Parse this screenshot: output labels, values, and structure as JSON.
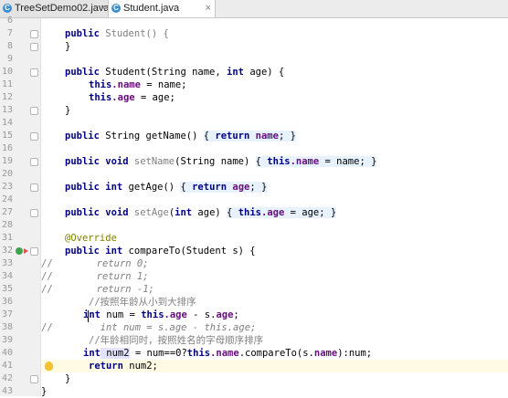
{
  "tabs": [
    {
      "label": "TreeSetDemo02.java",
      "icon": "java-class-icon",
      "active": false
    },
    {
      "label": "Student.java",
      "icon": "java-class-icon",
      "active": true
    }
  ],
  "line_numbers": [
    "6",
    "7",
    "8",
    "9",
    "10",
    "11",
    "12",
    "13",
    "14",
    "15",
    "16",
    "19",
    "20",
    "23",
    "24",
    "27",
    "28",
    "31",
    "32",
    "33",
    "34",
    "35",
    "36",
    "37",
    "38",
    "39",
    "40",
    "41",
    "42",
    "43"
  ],
  "code": {
    "l7": {
      "kw": "public",
      "name": "Student",
      "rest": "() {"
    },
    "l8": "}",
    "l10": {
      "kw": "public",
      "name": "Student(String name, ",
      "kw2": "int",
      "rest": " age) {"
    },
    "l11": {
      "kw": "this",
      "fld": ".name",
      "rest": " = name;"
    },
    "l12": {
      "kw": "this",
      "fld": ".age",
      "rest": " = age;"
    },
    "l13": "}",
    "l15": {
      "kw": "public",
      "name": " String getName() ",
      "ph1": "{ ",
      "kw2": "return",
      "fld": " name",
      "ph2": "; }"
    },
    "l19": {
      "kw": "public",
      "kw2": " void",
      "name": " setName",
      "rest": "(String name) ",
      "ph1": "{ ",
      "kw3": "this",
      "fld": ".name",
      "rest2": " = name; ",
      "ph2": "}"
    },
    "l23": {
      "kw": "public",
      "kw2": " int",
      "name": " getAge() ",
      "ph1": "{ ",
      "kw3": "return",
      "fld": " age",
      "ph2": "; }"
    },
    "l27": {
      "kw": "public",
      "kw2": " void",
      "name": " setAge",
      "rest": "(",
      "kw3": "int",
      "rest2": " age) ",
      "ph1": "{ ",
      "kw4": "this",
      "fld": ".age",
      "rest3": " = age; ",
      "ph2": "}"
    },
    "l31": "@Override",
    "l32": {
      "kw": "public",
      "kw2": " int",
      "rest": " compareTo(Student s) {"
    },
    "l33": {
      "slash": "//",
      "cmt": "return 0;"
    },
    "l34": {
      "slash": "//",
      "cmt": "return 1;"
    },
    "l35": {
      "slash": "//",
      "cmt": "return -1;"
    },
    "l36": "//按照年龄从小到大排序",
    "l37": {
      "kw": "int",
      "rest": " num = ",
      "kw2": "this",
      "fld": ".age",
      "rest2": " - s.",
      "fld2": "age",
      "rest3": ";"
    },
    "l38": {
      "slash": "//",
      "cmt": "int num = s.age - this.age;"
    },
    "l39": "//年龄相同时，按照姓名的字母顺序排序",
    "l40": {
      "kw": "int",
      "name": " num2",
      "rest": " = num==0?",
      "kw2": "this",
      "fld": ".name",
      "rest2": ".compareTo(s.",
      "fld2": "name",
      "rest3": "):num;"
    },
    "l41": {
      "kw": "return",
      "rest": " num2;"
    },
    "l42": "}",
    "l43": "}"
  },
  "colors": {
    "keyword": "#000080",
    "field": "#660e7a",
    "annotation": "#808000",
    "comment": "#808080",
    "caret_line": "#fffae3"
  }
}
